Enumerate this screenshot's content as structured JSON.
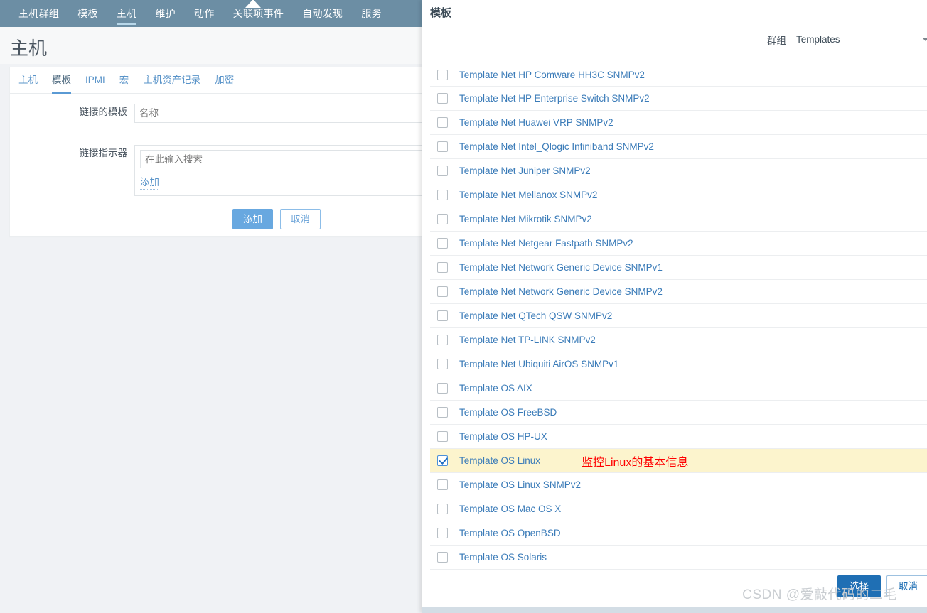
{
  "topnav": {
    "items": [
      {
        "label": "主机群组",
        "active": false
      },
      {
        "label": "模板",
        "active": false
      },
      {
        "label": "主机",
        "active": true
      },
      {
        "label": "维护",
        "active": false
      },
      {
        "label": "动作",
        "active": false
      },
      {
        "label": "关联项事件",
        "active": false
      },
      {
        "label": "自动发现",
        "active": false
      },
      {
        "label": "服务",
        "active": false
      }
    ]
  },
  "page": {
    "title": "主机"
  },
  "tabs": [
    {
      "label": "主机",
      "active": false
    },
    {
      "label": "模板",
      "active": true
    },
    {
      "label": "IPMI",
      "active": false
    },
    {
      "label": "宏",
      "active": false
    },
    {
      "label": "主机资产记录",
      "active": false
    },
    {
      "label": "加密",
      "active": false
    }
  ],
  "form": {
    "linked_templates_label": "链接的模板",
    "linked_templates_placeholder": "名称",
    "link_indicator_label": "链接指示器",
    "search_placeholder": "在此输入搜索",
    "add_link": "添加",
    "submit_label": "添加",
    "cancel_label": "取消"
  },
  "modal": {
    "title": "模板",
    "group_label": "群组",
    "group_value": "Templates",
    "select_label": "选择",
    "cancel_label": "取消",
    "templates": [
      {
        "name": "Template Net HP Comware HH3C SNMPv2",
        "checked": false,
        "annotation": ""
      },
      {
        "name": "Template Net HP Enterprise Switch SNMPv2",
        "checked": false,
        "annotation": ""
      },
      {
        "name": "Template Net Huawei VRP SNMPv2",
        "checked": false,
        "annotation": ""
      },
      {
        "name": "Template Net Intel_Qlogic Infiniband SNMPv2",
        "checked": false,
        "annotation": ""
      },
      {
        "name": "Template Net Juniper SNMPv2",
        "checked": false,
        "annotation": ""
      },
      {
        "name": "Template Net Mellanox SNMPv2",
        "checked": false,
        "annotation": ""
      },
      {
        "name": "Template Net Mikrotik SNMPv2",
        "checked": false,
        "annotation": ""
      },
      {
        "name": "Template Net Netgear Fastpath SNMPv2",
        "checked": false,
        "annotation": ""
      },
      {
        "name": "Template Net Network Generic Device SNMPv1",
        "checked": false,
        "annotation": ""
      },
      {
        "name": "Template Net Network Generic Device SNMPv2",
        "checked": false,
        "annotation": ""
      },
      {
        "name": "Template Net QTech QSW SNMPv2",
        "checked": false,
        "annotation": ""
      },
      {
        "name": "Template Net TP-LINK SNMPv2",
        "checked": false,
        "annotation": ""
      },
      {
        "name": "Template Net Ubiquiti AirOS SNMPv1",
        "checked": false,
        "annotation": ""
      },
      {
        "name": "Template OS AIX",
        "checked": false,
        "annotation": ""
      },
      {
        "name": "Template OS FreeBSD",
        "checked": false,
        "annotation": ""
      },
      {
        "name": "Template OS HP-UX",
        "checked": false,
        "annotation": ""
      },
      {
        "name": "Template OS Linux",
        "checked": true,
        "annotation": "监控Linux的基本信息"
      },
      {
        "name": "Template OS Linux SNMPv2",
        "checked": false,
        "annotation": ""
      },
      {
        "name": "Template OS Mac OS X",
        "checked": false,
        "annotation": ""
      },
      {
        "name": "Template OS OpenBSD",
        "checked": false,
        "annotation": ""
      },
      {
        "name": "Template OS Solaris",
        "checked": false,
        "annotation": ""
      }
    ]
  },
  "watermark": {
    "text": "CSDN @爱敲代码的二毛"
  },
  "colors": {
    "nav_bg": "#6c8ea4",
    "accent_blue": "#68a8e0",
    "link_blue": "#3a7bb8",
    "selected_row": "#fcf4cd",
    "annotation_red": "#ff0000",
    "modal_button_blue": "#1f6fb4"
  }
}
